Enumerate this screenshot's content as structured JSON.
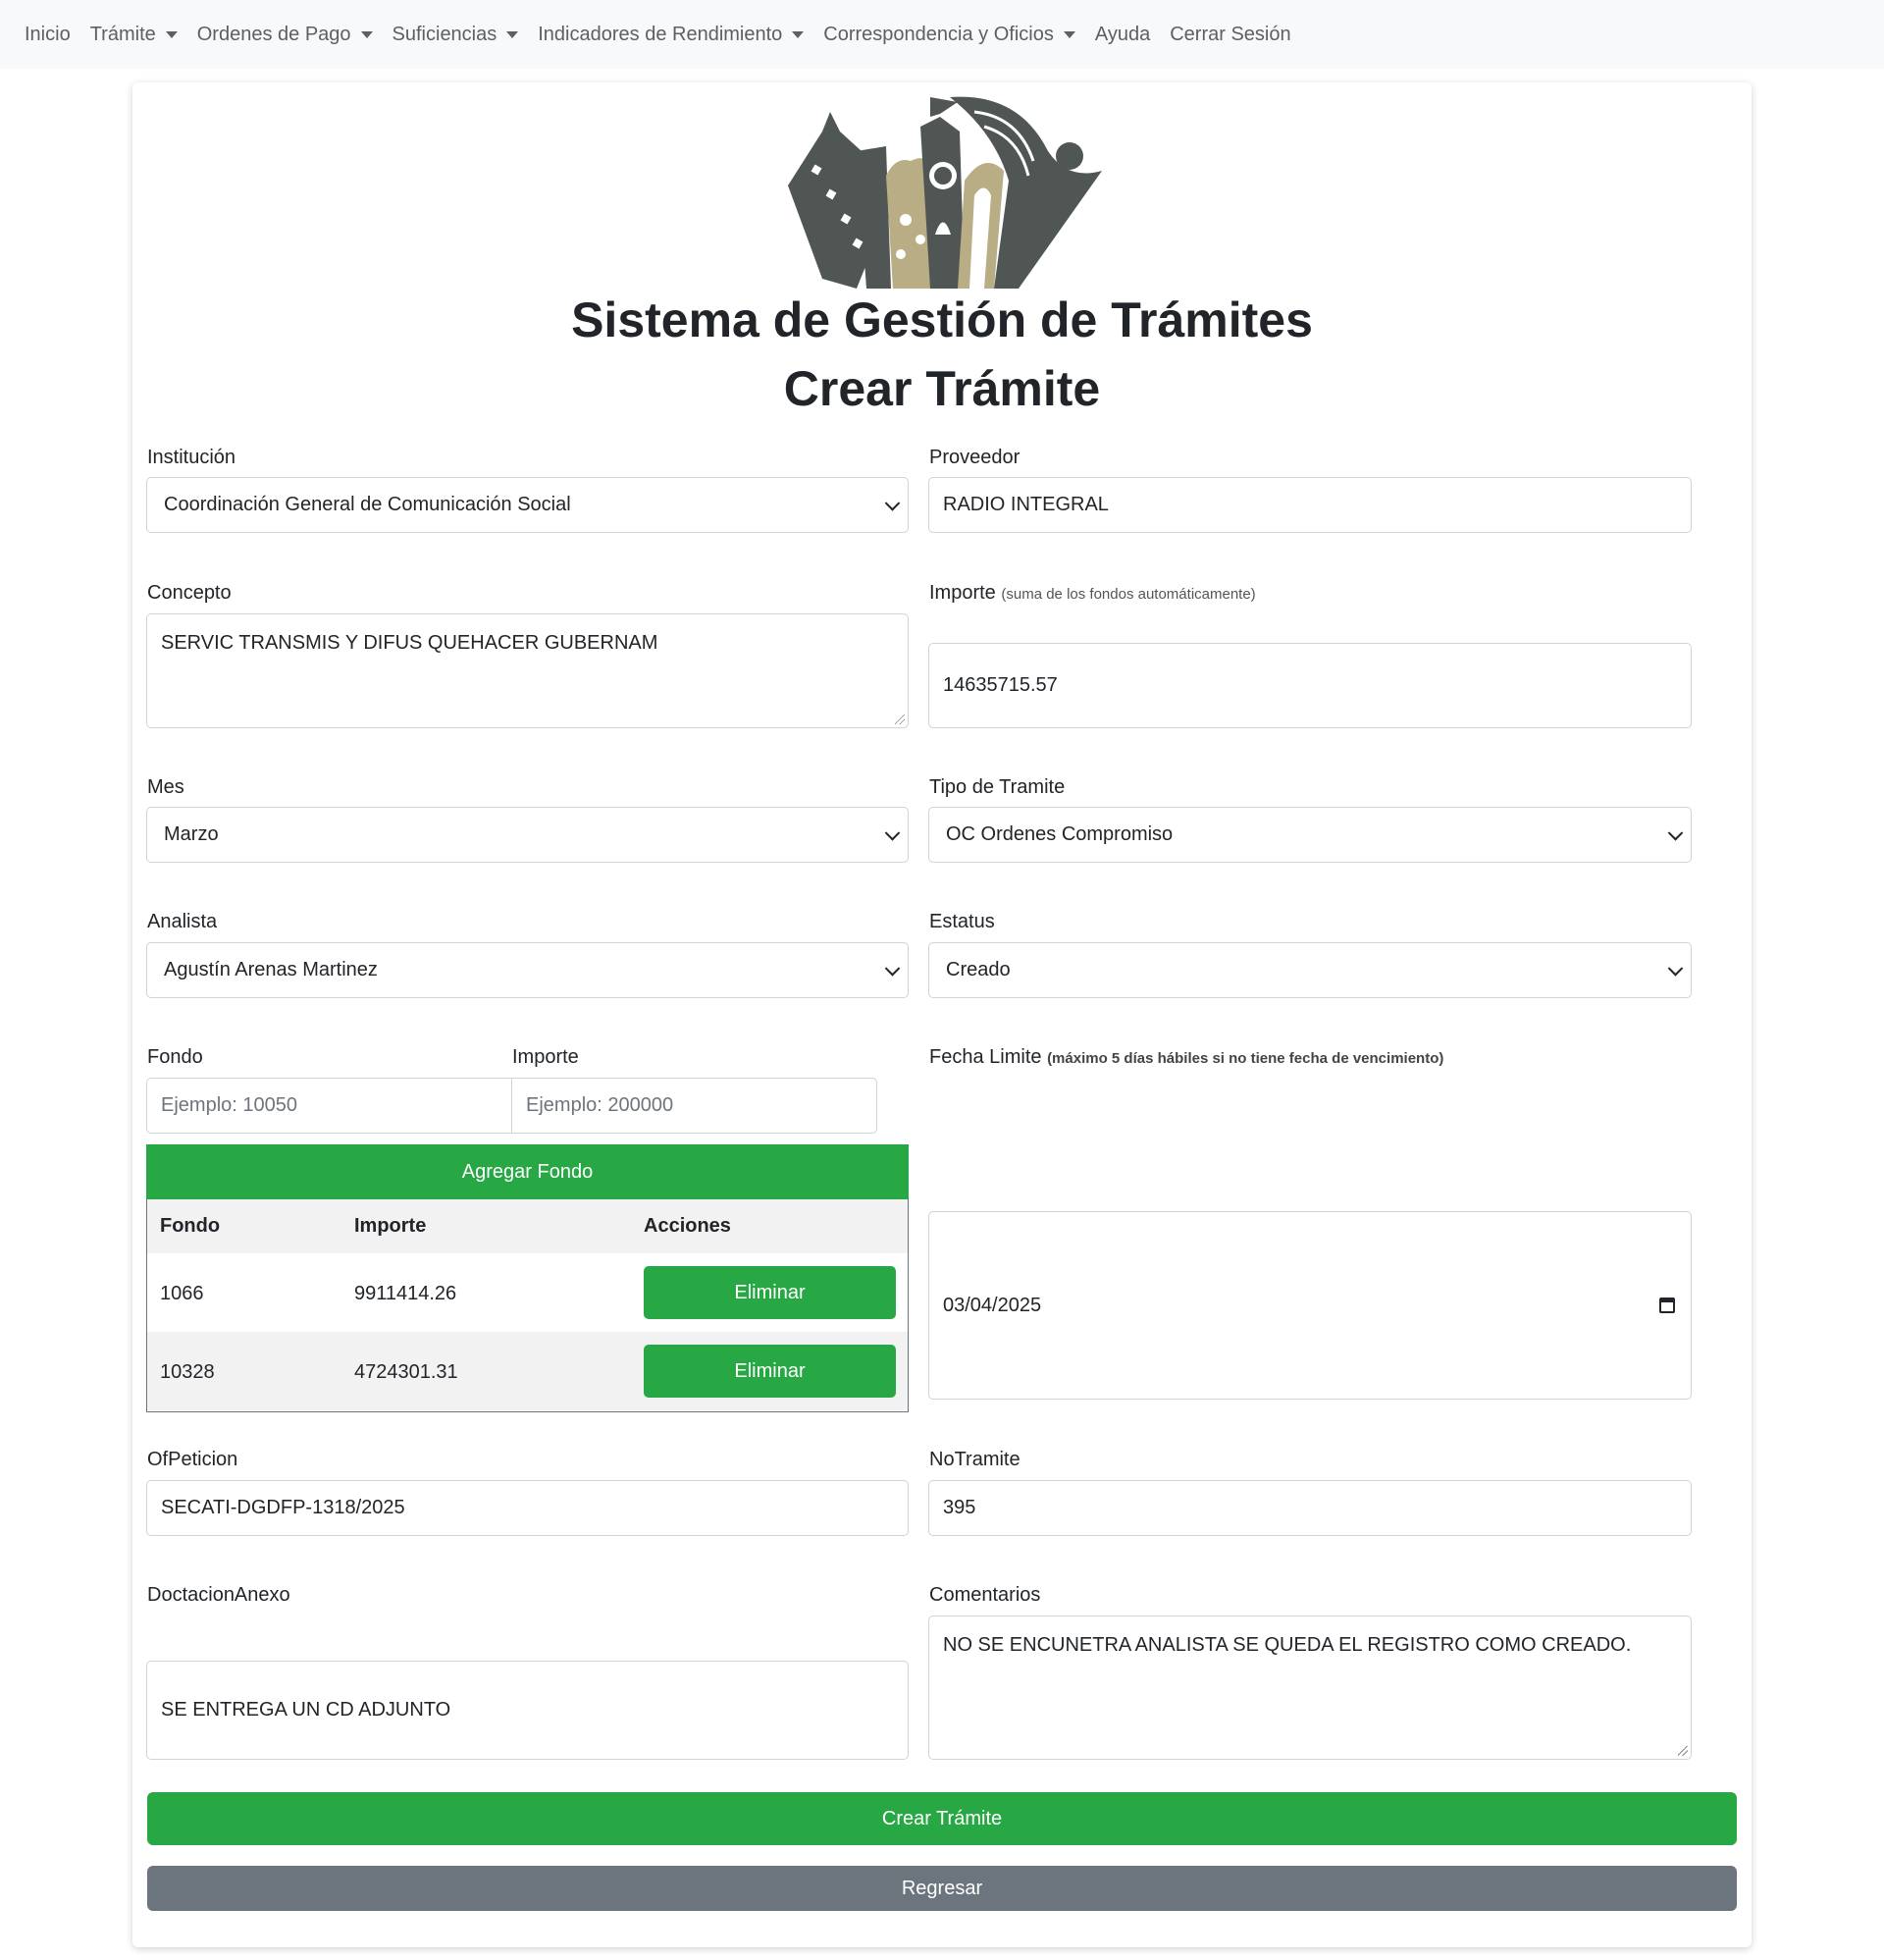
{
  "nav": {
    "items": [
      {
        "label": "Inicio",
        "dropdown": false
      },
      {
        "label": "Trámite",
        "dropdown": true
      },
      {
        "label": "Ordenes de Pago",
        "dropdown": true
      },
      {
        "label": "Suficiencias",
        "dropdown": true
      },
      {
        "label": "Indicadores de Rendimiento",
        "dropdown": true
      },
      {
        "label": "Correspondencia y Oficios",
        "dropdown": true
      },
      {
        "label": "Ayuda",
        "dropdown": false
      },
      {
        "label": "Cerrar Sesión",
        "dropdown": false
      }
    ]
  },
  "header": {
    "title": "Sistema de Gestión de Trámites",
    "subtitle": "Crear Trámite"
  },
  "form": {
    "institucion": {
      "label": "Institución",
      "value": "Coordinación General de Comunicación Social"
    },
    "proveedor": {
      "label": "Proveedor",
      "value": "RADIO INTEGRAL"
    },
    "concepto": {
      "label": "Concepto",
      "value": "SERVIC TRANSMIS Y DIFUS QUEHACER GUBERNAM"
    },
    "importe": {
      "label": "Importe",
      "hint": "(suma de los fondos automáticamente)",
      "value": "14635715.57"
    },
    "mes": {
      "label": "Mes",
      "value": "Marzo"
    },
    "tipo_tramite": {
      "label": "Tipo de Tramite",
      "value": "OC Ordenes Compromiso"
    },
    "analista": {
      "label": "Analista",
      "value": "Agustín Arenas Martinez"
    },
    "estatus": {
      "label": "Estatus",
      "value": "Creado"
    },
    "fondo": {
      "label": "Fondo",
      "placeholder": "Ejemplo: 10050"
    },
    "fondo_importe": {
      "label": "Importe",
      "placeholder": "Ejemplo: 200000"
    },
    "agregar_fondo": "Agregar Fondo",
    "fecha_limite": {
      "label": "Fecha Limite",
      "hint": "(máximo 5 días hábiles si no tiene fecha de vencimiento)",
      "value": "03/04/2025"
    },
    "ofpeticion": {
      "label": "OfPeticion",
      "value": "SECATI-DGDFP-1318/2025"
    },
    "notramite": {
      "label": "NoTramite",
      "value": "395"
    },
    "doctacion": {
      "label": "DoctacionAnexo",
      "value": "SE ENTREGA UN CD ADJUNTO"
    },
    "comentarios": {
      "label": "Comentarios",
      "value": "NO SE ENCUNETRA ANALISTA SE QUEDA EL REGISTRO COMO CREADO."
    },
    "submit": "Crear Trámite",
    "back": "Regresar"
  },
  "fondos_table": {
    "headers": [
      "Fondo",
      "Importe",
      "Acciones"
    ],
    "rows": [
      {
        "fondo": "1066",
        "importe": "9911414.26",
        "action": "Eliminar"
      },
      {
        "fondo": "10328",
        "importe": "4724301.31",
        "action": "Eliminar"
      }
    ]
  },
  "colors": {
    "accent": "#28a745",
    "secondary": "#6c757d",
    "navbar_bg": "#f8f9fa",
    "logo_dark": "#4f5654",
    "logo_gold": "#b9ad85"
  }
}
